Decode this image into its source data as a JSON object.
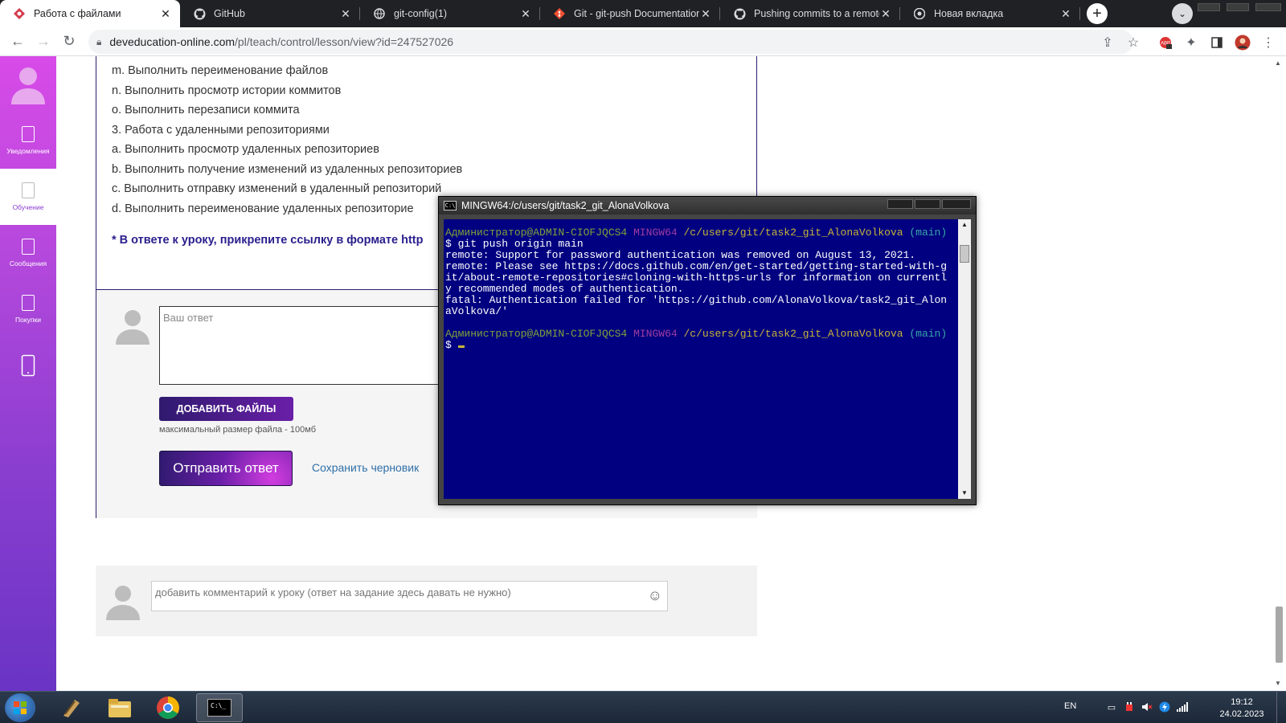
{
  "browser": {
    "tabs": [
      {
        "title": "Работа с файлами",
        "favicon": "devedu-diamond-icon",
        "active": true
      },
      {
        "title": "GitHub",
        "favicon": "github-icon",
        "active": false
      },
      {
        "title": "git-config(1)",
        "favicon": "globe-icon",
        "active": false
      },
      {
        "title": "Git - git-push Documentation",
        "favicon": "git-icon",
        "active": false
      },
      {
        "title": "Pushing commits to a remote r",
        "favicon": "github-icon",
        "active": false
      },
      {
        "title": "Новая вкладка",
        "favicon": "chrome-icon",
        "active": false
      }
    ],
    "address": {
      "host": "deveducation-online.com",
      "path": "/pl/teach/control/lesson/view?id=247527026"
    }
  },
  "sidebar": {
    "items": [
      {
        "label": "Уведомления",
        "active": false
      },
      {
        "label": "Обучение",
        "active": true
      },
      {
        "label": "Сообщения",
        "active": false
      },
      {
        "label": "Покупки",
        "active": false
      },
      {
        "label": "",
        "active": false
      }
    ]
  },
  "lesson": {
    "tasks": [
      "m. Выполнить переименование файлов",
      "n. Выполнить просмотр истории коммитов",
      "o. Выполнить перезаписи коммита",
      "3. Работа с удаленными репозиториями",
      "a. Выполнить просмотр удаленных репозиториев",
      "b. Выполнить получение изменений из удаленных репозиториев",
      "c. Выполнить отправку изменений в удаленный репозиторий",
      "d. Выполнить переименование удаленных репозиторие"
    ],
    "note": "* В ответе к уроку, прикрепите ссылку в формате http",
    "answer_placeholder": "Ваш ответ",
    "add_files_label": "ДОБАВИТЬ ФАЙЛЫ",
    "max_size_text": "максимальный размер файла - 100мб",
    "send_label": "Отправить ответ",
    "save_draft_label": "Сохранить черновик",
    "comment_placeholder": "добавить комментарий к уроку (ответ на задание здесь давать не нужно)"
  },
  "terminal": {
    "title": "MINGW64:/c/users/git/task2_git_AlonaVolkova",
    "prompt_user": "Администратор@ADMIN-CIOFJQCS4",
    "prompt_env": "MINGW64",
    "prompt_path": "/c/users/git/task2_git_AlonaVolkova",
    "prompt_branch": "(main)",
    "command": "$ git push origin main",
    "output": [
      "remote: Support for password authentication was removed on August 13, 2021.",
      "remote: Please see https://docs.github.com/en/get-started/getting-started-with-g",
      "it/about-remote-repositories#cloning-with-https-urls for information on currentl",
      "y recommended modes of authentication.",
      "fatal: Authentication failed for 'https://github.com/AlonaVolkova/task2_git_Alon",
      "aVolkova/'"
    ],
    "final_prompt": "$ "
  },
  "taskbar": {
    "language": "EN",
    "time": "19:12",
    "date": "24.02.2023"
  },
  "colors": {
    "terminal_bg": "#000080",
    "brand_purple": "#6a1fa8",
    "sidebar_top": "#d84be8"
  }
}
